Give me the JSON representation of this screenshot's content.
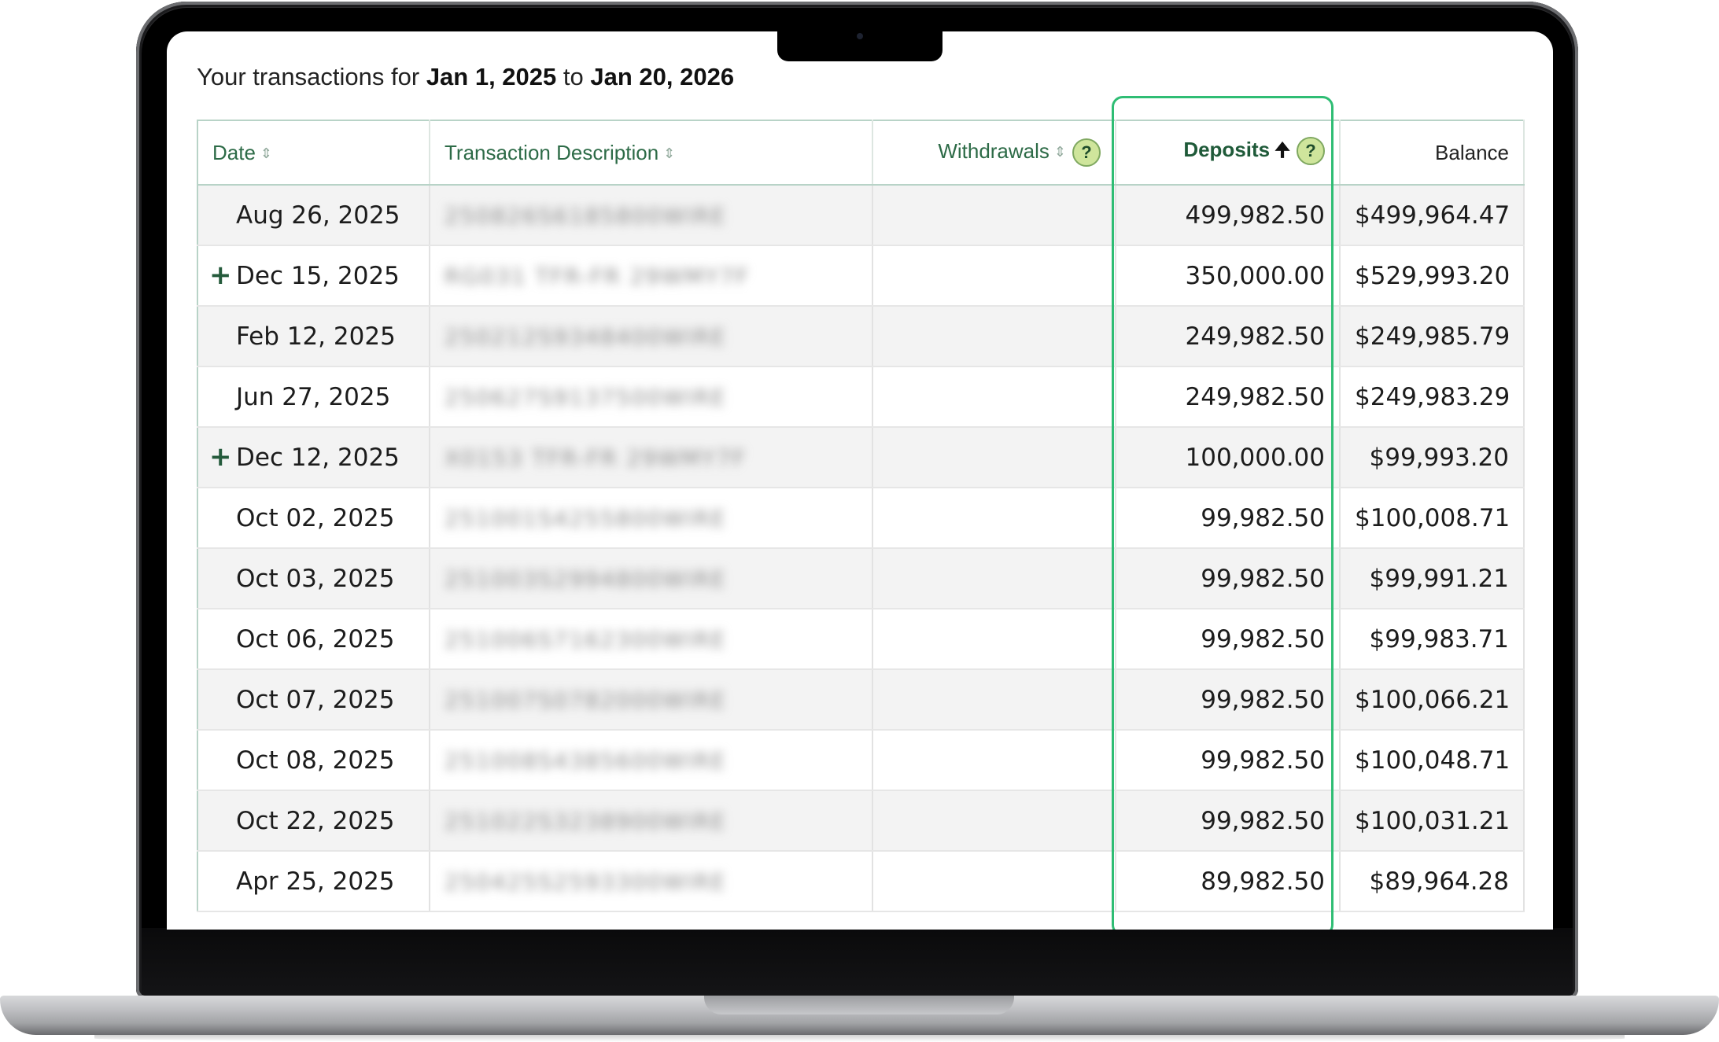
{
  "statement": {
    "intro": "Your transactions for",
    "start_date": "Jan 1, 2025",
    "connector": "to",
    "end_date": "Jan 20, 2026"
  },
  "table": {
    "headers": {
      "date": "Date",
      "description": "Transaction Description",
      "withdrawals": "Withdrawals",
      "deposits": "Deposits",
      "balance": "Balance",
      "help": "?"
    },
    "sort": {
      "column": "deposits",
      "direction": "descending"
    },
    "rows": [
      {
        "expandable": false,
        "expand_icon": "+",
        "date": "Aug 26, 2025",
        "description": "250826S6185800WIRE",
        "withdrawal": "",
        "deposit": "499,982.50",
        "balance": "$499,964.47"
      },
      {
        "expandable": true,
        "expand_icon": "+",
        "date": "Dec 15, 2025",
        "description": "RG031 TFR-FR 29WMY7F",
        "withdrawal": "",
        "deposit": "350,000.00",
        "balance": "$529,993.20"
      },
      {
        "expandable": false,
        "expand_icon": "+",
        "date": "Feb 12, 2025",
        "description": "250212S9348400WIRE",
        "withdrawal": "",
        "deposit": "249,982.50",
        "balance": "$249,985.79"
      },
      {
        "expandable": false,
        "expand_icon": "+",
        "date": "Jun 27, 2025",
        "description": "250627S9137500WIRE",
        "withdrawal": "",
        "deposit": "249,982.50",
        "balance": "$249,983.29"
      },
      {
        "expandable": true,
        "expand_icon": "+",
        "date": "Dec 12, 2025",
        "description": "X0153 TFR-FR 29WMY7F",
        "withdrawal": "",
        "deposit": "100,000.00",
        "balance": "$99,993.20"
      },
      {
        "expandable": false,
        "expand_icon": "+",
        "date": "Oct 02, 2025",
        "description": "251001S4255800WIRE",
        "withdrawal": "",
        "deposit": "99,982.50",
        "balance": "$100,008.71"
      },
      {
        "expandable": false,
        "expand_icon": "+",
        "date": "Oct 03, 2025",
        "description": "251003S2994800WIRE",
        "withdrawal": "",
        "deposit": "99,982.50",
        "balance": "$99,991.21"
      },
      {
        "expandable": false,
        "expand_icon": "+",
        "date": "Oct 06, 2025",
        "description": "251006S7162300WIRE",
        "withdrawal": "",
        "deposit": "99,982.50",
        "balance": "$99,983.71"
      },
      {
        "expandable": false,
        "expand_icon": "+",
        "date": "Oct 07, 2025",
        "description": "251007S0782000WIRE",
        "withdrawal": "",
        "deposit": "99,982.50",
        "balance": "$100,066.21"
      },
      {
        "expandable": false,
        "expand_icon": "+",
        "date": "Oct 08, 2025",
        "description": "251008S4385600WIRE",
        "withdrawal": "",
        "deposit": "99,982.50",
        "balance": "$100,048.71"
      },
      {
        "expandable": false,
        "expand_icon": "+",
        "date": "Oct 22, 2025",
        "description": "251022S3238900WIRE",
        "withdrawal": "",
        "deposit": "99,982.50",
        "balance": "$100,031.21"
      },
      {
        "expandable": false,
        "expand_icon": "+",
        "date": "Apr 25, 2025",
        "description": "250425S2593300WIRE",
        "withdrawal": "",
        "deposit": "89,982.50",
        "balance": "$89,964.28"
      }
    ]
  },
  "colors": {
    "header_text": "#2d6b47",
    "highlight_border": "#2fbd74",
    "row_stripe": "#f3f3f3",
    "help_icon_fill": "#cfe59c"
  },
  "icons": {
    "sort_both": "sort-up-down-icon",
    "sort_active": "arrow-up-icon",
    "help": "question-circle-icon",
    "expand": "plus-icon"
  }
}
